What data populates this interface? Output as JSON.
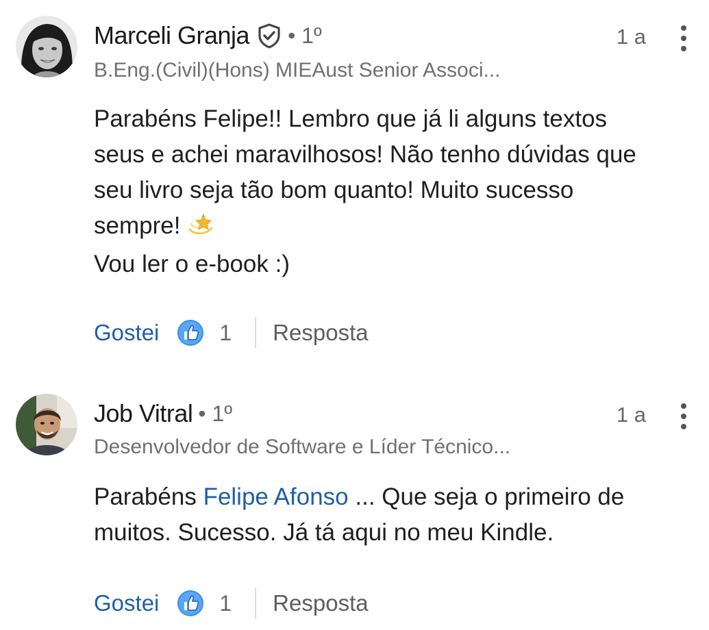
{
  "comments": [
    {
      "author": "Marceli Granja",
      "degree": "• 1º",
      "time": "1 a",
      "headline": "B.Eng.(Civil)(Hons) MIEAust Senior Associ...",
      "body_lines": [
        "Parabéns Felipe!! Lembro que já li alguns textos",
        "seus e achei maravilhosos! Não tenho dúvidas que",
        "seu livro seja tão bom quanto! Muito sucesso",
        "sempre!",
        "Vou ler o e-book :)"
      ],
      "emoji": "dizzy-star-icon",
      "like_label": "Gostei",
      "like_count": "1",
      "reply_label": "Resposta",
      "verified": true
    },
    {
      "author": "Job Vitral",
      "degree": "• 1º",
      "time": "1 a",
      "headline": "Desenvolvedor de Software e Líder Técnico...",
      "body_prefix": "Parabéns ",
      "mention": "Felipe Afonso",
      "body_suffix": " ... Que seja o primeiro de",
      "body_line2": "muitos. Sucesso. Já tá aqui no meu Kindle.",
      "like_label": "Gostei",
      "like_count": "1",
      "reply_label": "Resposta",
      "verified": false
    }
  ],
  "colors": {
    "link_blue": "#1f5fa8",
    "like_icon_blue": "#378fe9",
    "text_primary": "#1f1f1f",
    "text_secondary": "#666666"
  }
}
